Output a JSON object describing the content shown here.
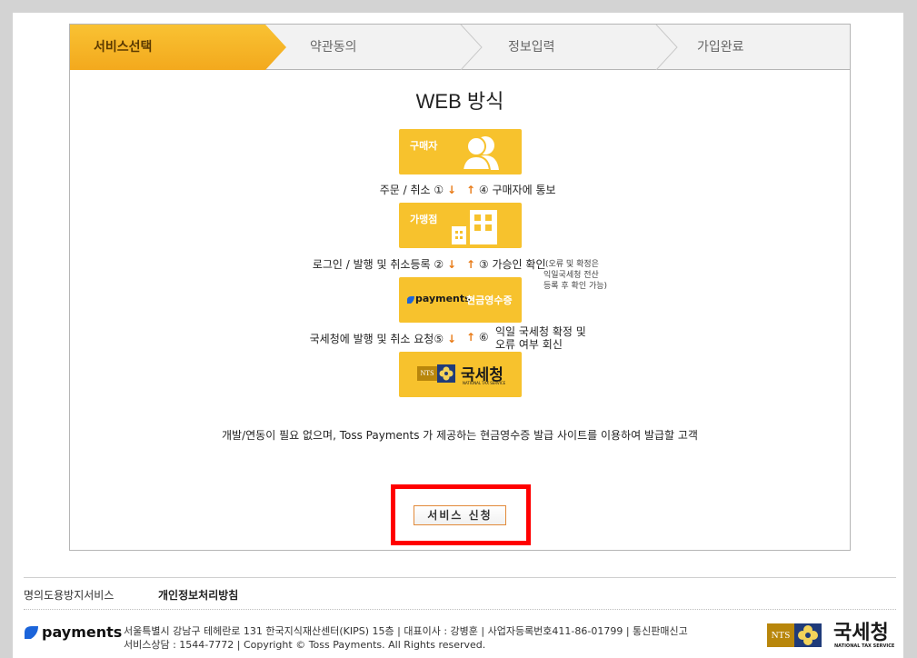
{
  "steps": [
    {
      "label": "서비스선택",
      "active": true
    },
    {
      "label": "약관동의",
      "active": false
    },
    {
      "label": "정보입력",
      "active": false
    },
    {
      "label": "가입완료",
      "active": false
    }
  ],
  "main": {
    "title": "WEB 방식",
    "boxes": {
      "buyer": "구매자",
      "merchant": "가맹점",
      "payments_brand": "payments",
      "payments_sub": "현금영수증",
      "nts_brand": "NTS",
      "nts_name": "국세청",
      "nts_sub": "NATIONAL TAX SERVICE"
    },
    "flows": [
      {
        "left": "주문 / 취소 ①",
        "right": "④ 구매자에 통보"
      },
      {
        "left": "로그인 / 발행 및 취소등록 ②",
        "right": "③ 가승인 확인",
        "note1": "(오류 및 확정은",
        "note2": "익일국세청 전산",
        "note3": "등록 후 확인 가능)"
      },
      {
        "left": "국세청에 발행 및 취소 요청⑤",
        "right": "⑥",
        "right2a": "익일 국세청 확정 및",
        "right2b": "오류 여부 회신"
      }
    ],
    "arrows": {
      "down": "↓",
      "up": "↑"
    },
    "description": "개발/연동이 필요 없으며, Toss Payments 가 제공하는 현금영수증 발급 사이트를 이용하여 발급할 고객",
    "apply_button": "서비스 신청"
  },
  "footer": {
    "link_spam": "명의도용방지서비스",
    "link_privacy": "개인정보처리방침",
    "brand": "payments",
    "address": "서울특별시 강남구 테헤란로 131 한국지식재산센터(KIPS) 15층 | 대표이사 : 강병훈 | 사업자등록번호411-86-01799 | 통신판매신고",
    "contact": "서비스상담 : 1544-7772 | Copyright © Toss Payments. All Rights reserved.",
    "nts_brand": "NTS",
    "nts_name": "국세청",
    "nts_sub": "NATIONAL TAX SERVICE"
  },
  "colors": {
    "step_active": "#f7b527",
    "box_yellow": "#f7c22d",
    "arrow": "#e87a16",
    "highlight": "#ff0000"
  }
}
